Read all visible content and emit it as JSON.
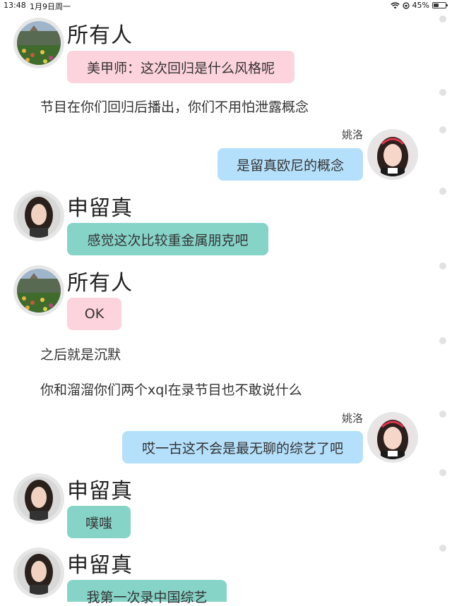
{
  "status_bar": {
    "time": "13:48",
    "date": "1月9日周一",
    "battery_percent": "45%",
    "battery_level": 0.45
  },
  "messages": [
    {
      "sender": "所有人",
      "text": "美甲师：这次回归是什么风格呢"
    },
    {
      "narration": "节目在你们回归后播出，你们不用怕泄露概念"
    },
    {
      "sender": "姚洛",
      "text": "是留真欧尼的概念"
    },
    {
      "sender": "申留真",
      "text": "感觉这次比较重金属朋克吧"
    },
    {
      "sender": "所有人",
      "text": "OK"
    },
    {
      "narration": "之后就是沉默"
    },
    {
      "narration": "你和溜溜你们两个xql在录节目也不敢说什么"
    },
    {
      "sender": "姚洛",
      "text": "哎一古这不会是最无聊的综艺了吧"
    },
    {
      "sender": "申留真",
      "text": "噗嗤"
    },
    {
      "sender": "申留真",
      "text": "我第一次录中国综艺"
    }
  ],
  "colors": {
    "pink_bubble": "#fdd3dd",
    "teal_bubble": "#86d4c8",
    "blue_bubble": "#b5e0fb",
    "dot": "#e2e2e2"
  }
}
